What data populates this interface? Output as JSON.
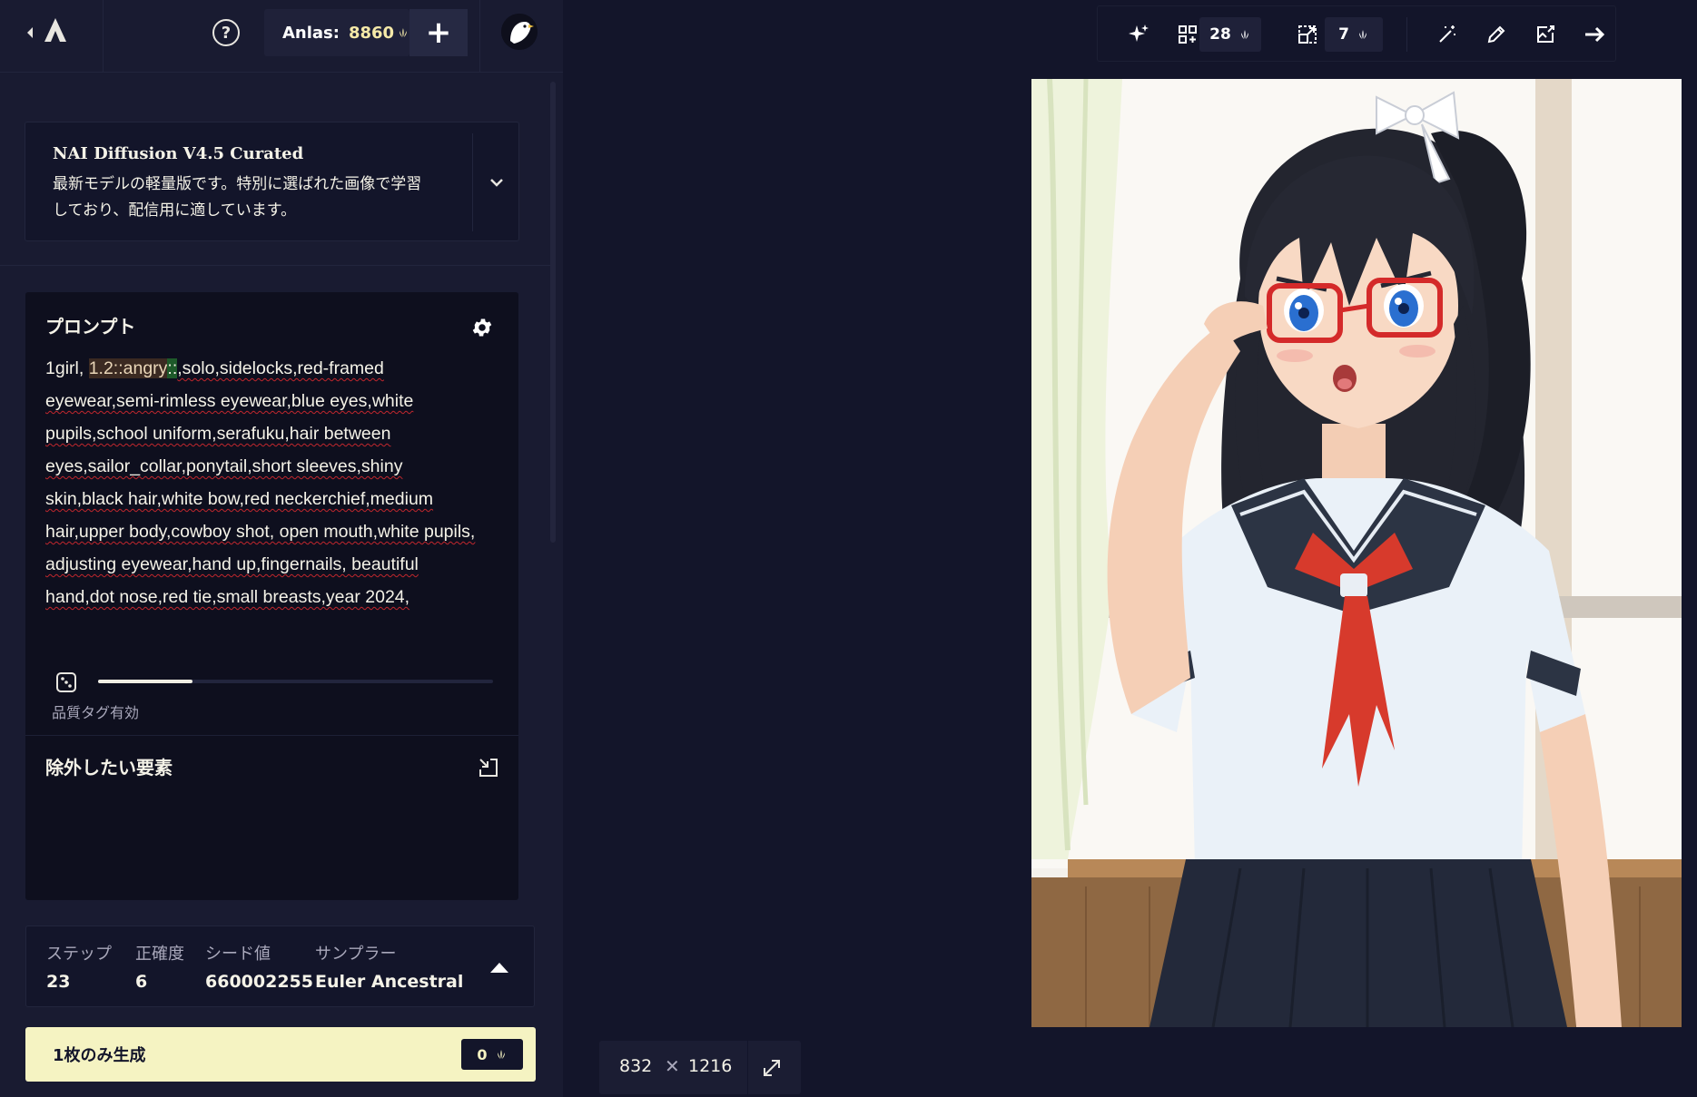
{
  "topbar": {
    "help_label": "?",
    "anlas_label": "Anlas:",
    "anlas_value": "8860",
    "plus_label": "+"
  },
  "model": {
    "name": "NAI Diffusion V4.5 Curated",
    "description": "最新モデルの軽量版です。特別に選ばれた画像で学習しており、配信用に適しています。"
  },
  "prompt": {
    "title": "プロンプト",
    "text_before": "1girl, ",
    "emphasis": "1.2::angry",
    "emphasis_end": "::",
    "text_after": ",solo,sidelocks,red-framed eyewear,semi-rimless eyewear,blue eyes,white pupils,school uniform,serafuku,hair between eyes,sailor_collar,ponytail,short sleeves,shiny skin,black hair,white bow,red neckerchief,medium hair,upper body,cowboy shot, open mouth,white pupils, adjusting eyewear,hand up,fingernails, beautiful hand,dot nose,red tie,small breasts,year 2024,",
    "quality_tags_label": "品質タグ有効",
    "quality_strength": 0.24
  },
  "negative": {
    "title": "除外したい要素",
    "text": ""
  },
  "settings": {
    "steps_label": "ステップ",
    "steps_value": "23",
    "guidance_label": "正確度",
    "guidance_value": "6",
    "seed_label": "シード値",
    "seed_value": "660002255",
    "sampler_label": "サンプラー",
    "sampler_value": "Euler Ancestral"
  },
  "generate": {
    "label": "1枚のみ生成",
    "cost": "0"
  },
  "toolbar": {
    "variations_cost": "28",
    "upscale_cost": "7"
  },
  "image": {
    "width": "832",
    "height": "1216",
    "times_symbol": "✕"
  },
  "colors": {
    "background": "#13152a",
    "sidebar": "#191b31",
    "accent": "#f5f3c2",
    "spellcheck": "#c2272d"
  }
}
